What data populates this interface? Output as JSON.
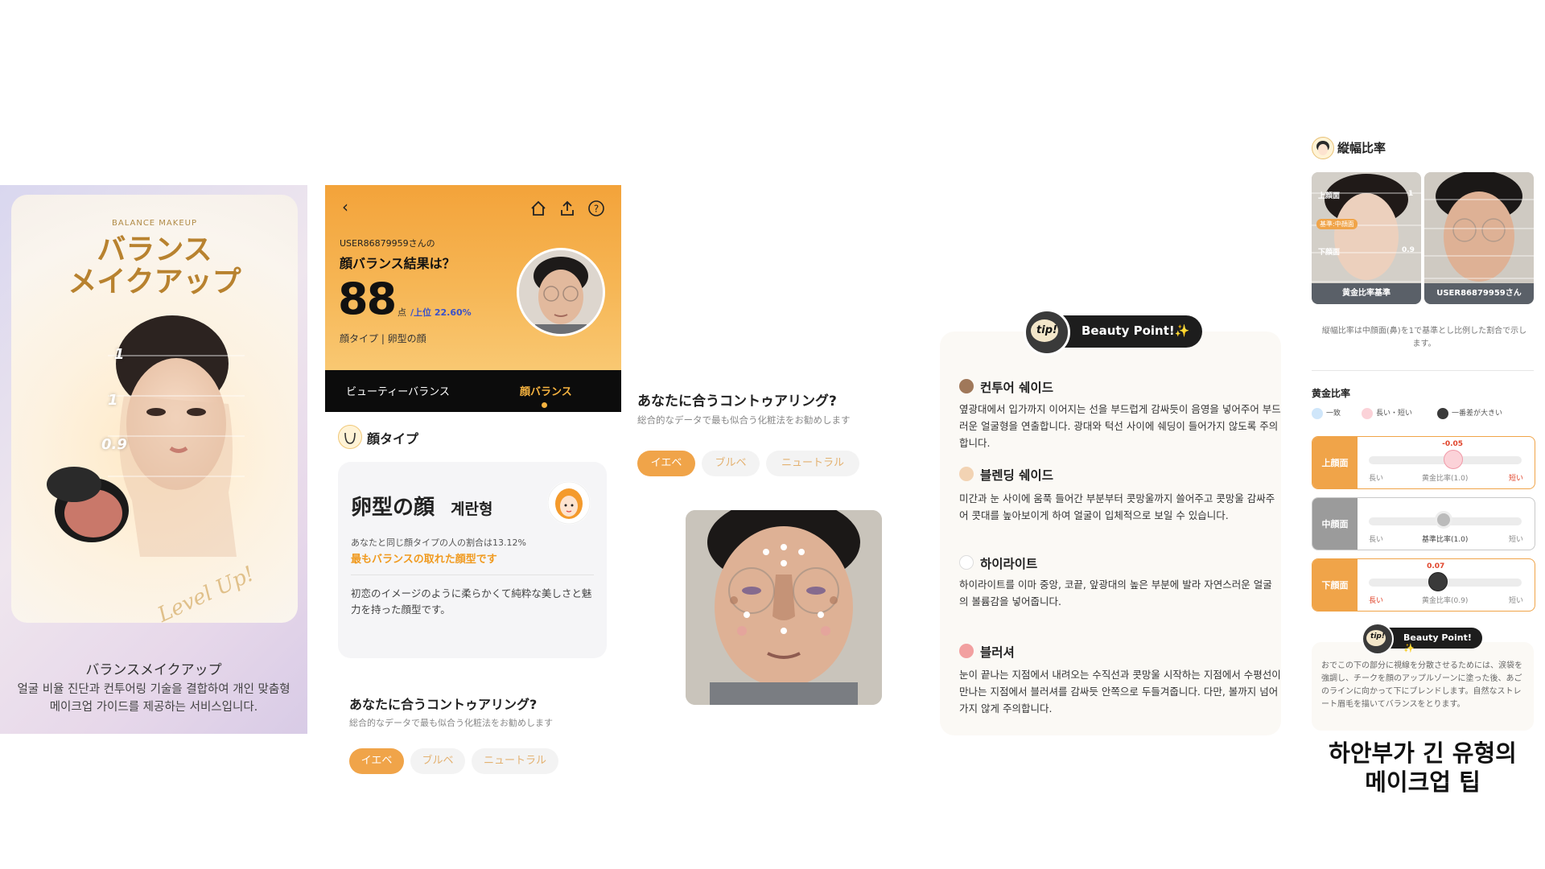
{
  "promo": {
    "brand": "BALANCE MAKEUP",
    "title": "バランス\nメイクアップ",
    "ratio_labels": [
      "1",
      "1",
      "0.9"
    ],
    "watermark": "Level Up!",
    "subtitle": "バランスメイクアップ",
    "description": "얼굴 비율 진단과 컨투어링 기술을 결합하여 개인 맞춤형 메이크업 가이드를 제공하는 서비스입니다."
  },
  "result": {
    "icons": [
      "back-icon",
      "home-icon",
      "share-icon",
      "help-icon"
    ],
    "user_line": "USER86879959さんの",
    "question": "顔バランス結果は？",
    "score": "88",
    "score_unit": "点",
    "rank": "/上位 22.60%",
    "face_type_line": "顔タイプ | 卵型の顔",
    "tabs": [
      "ビューティーバランス",
      "顔バランス"
    ],
    "section_title": "顔タイプ",
    "card": {
      "face_type_jp": "卵型の顔",
      "face_type_ko": "계란형",
      "ratio_text": "あなたと同じ顔タイプの人の割合は13.12%",
      "highlight": "最もバランスの取れた顔型です",
      "description": "初恋のイメージのように柔らかくて純粋な美しさと魅力を持った顔型です。"
    },
    "contour_question": "あなたに合うコントゥアリング?",
    "contour_sub": "総合的なデータで最も似合う化粧法をお勧めします",
    "chips": [
      "イエベ",
      "ブルベ",
      "ニュートラル"
    ]
  },
  "contour": {
    "question": "あなたに合うコントゥアリング?",
    "sub": "総合的なデータで最も似合う化粧法をお勧めします",
    "chips": [
      "イエベ",
      "ブルベ",
      "ニュートラル"
    ]
  },
  "beauty_point": {
    "tip_label": "tip!",
    "badge": "Beauty Point!✨",
    "items": [
      {
        "title": "컨투어 쉐이드",
        "color": "#a0785a",
        "body": "옆광대에서 입가까지 이어지는 선을 부드럽게 감싸듯이 음영을 넣어주어 부드러운 얼굴형을 연출합니다. 광대와 턱선 사이에 쉐딩이 들어가지 않도록 주의합니다."
      },
      {
        "title": "블렌딩 쉐이드",
        "color": "#f2d3b3",
        "body": "미간과 눈 사이에 움푹 들어간 부분부터 콧망울까지 쓸어주고 콧망울 감싸주어 콧대를 높아보이게 하여 얼굴이 입체적으로 보일 수 있습니다."
      },
      {
        "title": "하이라이트",
        "color": "#ffffff",
        "body": "하이라이트를 이마 중앙, 코끝, 앞광대의 높은 부분에 발라 자연스러운 얼굴의 볼륨감을 넣어줍니다."
      },
      {
        "title": "블러셔",
        "color": "#f2a0a0",
        "body": "눈이 끝나는 지점에서 내려오는 수직선과 콧망울 시작하는 지점에서 수평선이 만나는 지점에서 블러셔를 감싸듯 안쪽으로 두들겨줍니다. 다만, 볼까지 넘어가지 않게 주의합니다."
      }
    ]
  },
  "ratio": {
    "title": "縦幅比率",
    "photo_labels": [
      "上顔面",
      "基準:中顔面",
      "下顔面"
    ],
    "photo_values": [
      "1",
      "0.9"
    ],
    "photos": [
      "黄金比率基準",
      "USER86879959さん"
    ],
    "note": "縦幅比率は中顔面(鼻)を1で基準とし比例した割合で示します。",
    "golden_title": "黄金比率",
    "legend": [
      "一致",
      "長い・短い",
      "一番差が大きい"
    ],
    "meters": [
      {
        "label": "上顔面",
        "value": "-0.05",
        "left": "長い",
        "center": "黄金比率(1.0)",
        "right": "短い",
        "position": 0.49
      },
      {
        "label": "中顔面",
        "value": "",
        "left": "長い",
        "center": "基準比率(1.0)",
        "right": "短い",
        "position": 0.43
      },
      {
        "label": "下顔面",
        "value": "0.07",
        "left": "長い",
        "center": "黄金比率(0.9)",
        "right": "短い",
        "position": 0.39
      }
    ],
    "tip_label": "tip!",
    "badge": "Beauty Point!✨",
    "tip_text": "おでこの下の部分に視線を分散させるためには、涙袋を強調し、チークを顔のアップルゾーンに塗った後、あごのラインに向かって下にブレンドします。自然なストレート眉毛を描いてバランスをとります。",
    "headline": "하안부가 긴 유형의\n메이크업 팁"
  },
  "colors": {
    "accent": "#f0a449",
    "header_gradient_top": "#f3a33a",
    "rank_blue": "#3b52c9",
    "dark": "#1d1d1d"
  }
}
